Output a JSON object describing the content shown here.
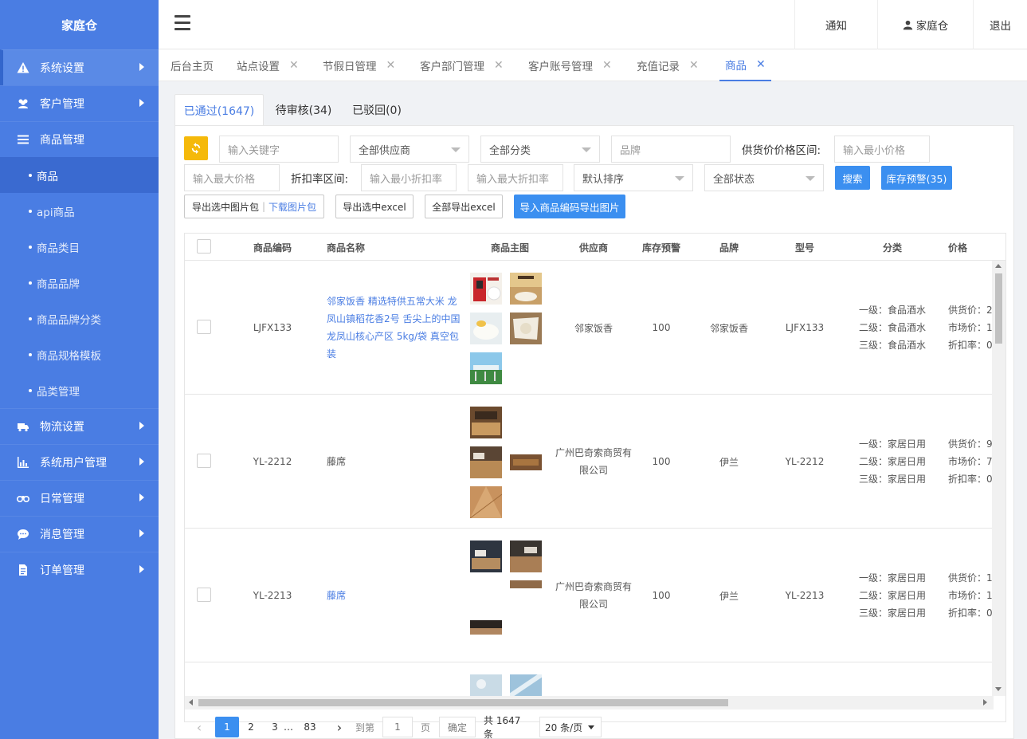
{
  "app": {
    "title": "家庭仓"
  },
  "sidebar": {
    "items": [
      {
        "label": "系统设置",
        "icon": "warning-icon"
      },
      {
        "label": "客户管理",
        "icon": "users-icon"
      },
      {
        "label": "商品管理",
        "icon": "list-icon"
      },
      {
        "label": "物流设置",
        "icon": "truck-icon"
      },
      {
        "label": "系统用户管理",
        "icon": "bar-chart-icon"
      },
      {
        "label": "日常管理",
        "icon": "binoculars-icon"
      },
      {
        "label": "消息管理",
        "icon": "chat-icon"
      },
      {
        "label": "订单管理",
        "icon": "document-icon"
      }
    ],
    "sub_items": [
      "商品",
      "api商品",
      "商品类目",
      "商品品牌",
      "商品品牌分类",
      "商品规格模板",
      "品类管理"
    ]
  },
  "header": {
    "notify": "通知",
    "user": "家庭仓",
    "logout": "退出"
  },
  "tabs": [
    {
      "label": "后台主页"
    },
    {
      "label": "站点设置"
    },
    {
      "label": "节假日管理"
    },
    {
      "label": "客户部门管理"
    },
    {
      "label": "客户账号管理"
    },
    {
      "label": "充值记录"
    },
    {
      "label": "商品"
    }
  ],
  "subtabs": [
    "已通过(1647)",
    "待审核(34)",
    "已驳回(0)"
  ],
  "filters": {
    "keyword_placeholder": "输入关键字",
    "supplier": "全部供应商",
    "category": "全部分类",
    "brand_placeholder": "品牌",
    "price_range_label": "供货价价格区间:",
    "min_price_placeholder": "输入最小价格",
    "max_price_placeholder": "输入最大价格",
    "discount_label": "折扣率区间:",
    "min_discount_placeholder": "输入最小折扣率",
    "max_discount_placeholder": "输入最大折扣率",
    "sort": "默认排序",
    "status": "全部状态",
    "search_btn": "搜索",
    "stock_alert_btn": "库存预警(35)"
  },
  "actions": {
    "export_images": "导出选中图片包",
    "download_images": "下载图片包",
    "export_excel": "导出选中excel",
    "export_all": "全部导出excel",
    "import_codes": "导入商品编码导出图片"
  },
  "table": {
    "headers": [
      "商品编码",
      "商品名称",
      "商品主图",
      "供应商",
      "库存预警",
      "品牌",
      "型号",
      "分类",
      "价格"
    ],
    "rows": [
      {
        "code": "LJFX133",
        "name": "邻家饭香 精选特供五常大米 龙凤山镇稻花香2号 舌尖上的中国龙凤山核心产区 5kg/袋 真空包装",
        "supplier": "邻家饭香",
        "stock": "100",
        "brand": "邻家饭香",
        "model": "LJFX133",
        "cat1": "一级：食品酒水",
        "cat2": "二级：食品酒水",
        "cat3": "三级：食品酒水",
        "price1": "供货价：2",
        "price2": "市场价：1",
        "price3": "折扣率：0"
      },
      {
        "code": "YL-2212",
        "name": "藤席",
        "supplier": "广州巴奇索商贸有限公司",
        "stock": "100",
        "brand": "伊兰",
        "model": "YL-2212",
        "cat1": "一级：家居日用",
        "cat2": "二级：家居日用",
        "cat3": "三级：家居日用",
        "price1": "供货价：9",
        "price2": "市场价：7",
        "price3": "折扣率：0"
      },
      {
        "code": "YL-2213",
        "name": "藤席",
        "supplier": "广州巴奇索商贸有限公司",
        "stock": "100",
        "brand": "伊兰",
        "model": "YL-2213",
        "cat1": "一级：家居日用",
        "cat2": "二级：家居日用",
        "cat3": "三级：家居日用",
        "price1": "供货价：1",
        "price2": "市场价：1",
        "price3": "折扣率：0"
      }
    ]
  },
  "pagination": {
    "pages": [
      "1",
      "2",
      "3",
      "…",
      "83"
    ],
    "goto_label": "到第",
    "goto_value": "1",
    "page_unit": "页",
    "confirm": "确定",
    "total": "共 1647 条",
    "per_page": "20 条/页"
  },
  "colors": {
    "sidebar": "#4a7de3",
    "accent": "#3b8ff0",
    "refresh": "#f5b90a"
  }
}
